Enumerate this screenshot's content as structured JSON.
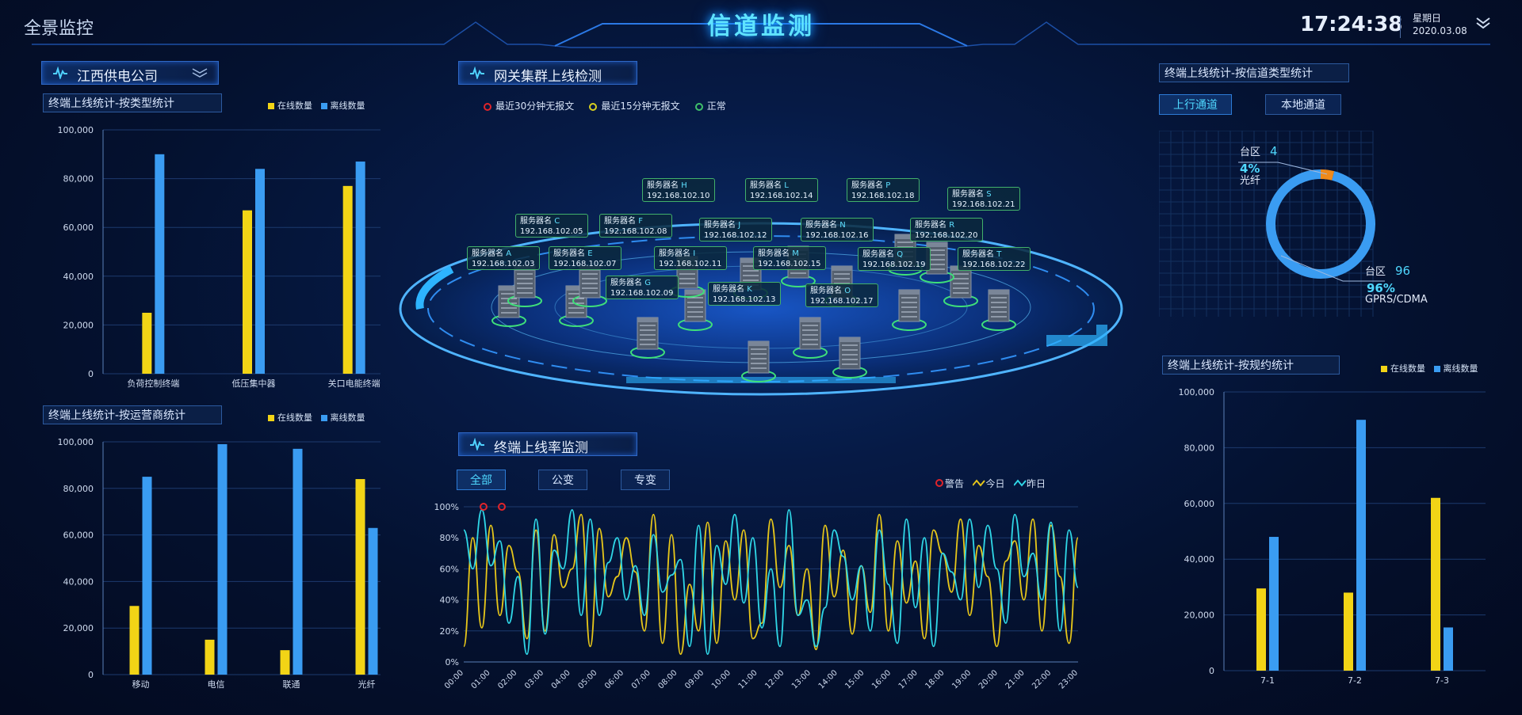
{
  "header": {
    "brand": "全景监控",
    "title": "信道监测",
    "time": "17:24:38",
    "weekday": "星期日",
    "date": "2020.03.08"
  },
  "left_panel": {
    "company": "江西供电公司"
  },
  "chart_type": {
    "title": "终端上线统计-按类型统计",
    "legend_online": "在线数量",
    "legend_offline": "离线数量"
  },
  "chart_operator": {
    "title": "终端上线统计-按运营商统计",
    "legend_online": "在线数量",
    "legend_offline": "离线数量"
  },
  "gateway": {
    "title": "网关集群上线检测",
    "legend": [
      "最近30分钟无报文",
      "最近15分钟无报文",
      "正常"
    ],
    "legend_colors": [
      "#e0242a",
      "#d8d020",
      "#3fc06a"
    ],
    "servers": [
      {
        "name": "服务器名",
        "id": "A",
        "ip": "192.168.102.03"
      },
      {
        "name": "服务器名",
        "id": "C",
        "ip": "192.168.102.05"
      },
      {
        "name": "服务器名",
        "id": "E",
        "ip": "192.168.102.07"
      },
      {
        "name": "服务器名",
        "id": "F",
        "ip": "192.168.102.08"
      },
      {
        "name": "服务器名",
        "id": "G",
        "ip": "192.168.102.09"
      },
      {
        "name": "服务器名",
        "id": "H",
        "ip": "192.168.102.10"
      },
      {
        "name": "服务器名",
        "id": "I",
        "ip": "192.168.102.11"
      },
      {
        "name": "服务器名",
        "id": "J",
        "ip": "192.168.102.12"
      },
      {
        "name": "服务器名",
        "id": "K",
        "ip": "192.168.102.13"
      },
      {
        "name": "服务器名",
        "id": "L",
        "ip": "192.168.102.14"
      },
      {
        "name": "服务器名",
        "id": "M",
        "ip": "192.168.102.15"
      },
      {
        "name": "服务器名",
        "id": "N",
        "ip": "192.168.102.16"
      },
      {
        "name": "服务器名",
        "id": "O",
        "ip": "192.168.102.17"
      },
      {
        "name": "服务器名",
        "id": "P",
        "ip": "192.168.102.18"
      },
      {
        "name": "服务器名",
        "id": "Q",
        "ip": "192.168.102.19"
      },
      {
        "name": "服务器名",
        "id": "R",
        "ip": "192.168.102.20"
      },
      {
        "name": "服务器名",
        "id": "S",
        "ip": "192.168.102.21"
      },
      {
        "name": "服务器名",
        "id": "T",
        "ip": "192.168.102.22"
      }
    ]
  },
  "rate": {
    "title": "终端上线率监测",
    "tabs": [
      "全部",
      "公变",
      "专变"
    ],
    "legend": [
      "警告",
      "今日",
      "昨日"
    ]
  },
  "channel": {
    "title": "终端上线统计-按信道类型统计",
    "tabs": [
      "上行通道",
      "本地通道"
    ],
    "slices": [
      {
        "label": "台区",
        "count": "4",
        "pct": "4%",
        "name": "光纤",
        "value": 4,
        "color": "#f08a1a"
      },
      {
        "label": "台区",
        "count": "96",
        "pct": "96%",
        "name": "GPRS/CDMA",
        "value": 96,
        "color": "#3a9cf2"
      }
    ]
  },
  "protocol": {
    "title": "终端上线统计-按规约统计",
    "legend_online": "在线数量",
    "legend_offline": "离线数量"
  },
  "colors": {
    "online": "#f2d416",
    "offline": "#3a9cf2",
    "today": "#e6c61a",
    "yesterday": "#2fd6e6",
    "warn": "#e0242a"
  },
  "chart_data": [
    {
      "type": "bar",
      "title": "终端上线统计-按类型统计",
      "categories": [
        "负荷控制终端",
        "低压集中器",
        "关口电能终端"
      ],
      "series": [
        {
          "name": "在线数量",
          "values": [
            25000,
            67000,
            77000
          ]
        },
        {
          "name": "离线数量",
          "values": [
            90000,
            84000,
            87000
          ]
        }
      ],
      "ylim": [
        0,
        100000
      ],
      "yticks": [
        "0",
        "20,000",
        "40,000",
        "60,000",
        "80,000",
        "100,000"
      ]
    },
    {
      "type": "bar",
      "title": "终端上线统计-按运营商统计",
      "categories": [
        "移动",
        "电信",
        "联通",
        "光纤"
      ],
      "series": [
        {
          "name": "在线数量",
          "values": [
            29500,
            15000,
            10500,
            84000
          ]
        },
        {
          "name": "离线数量",
          "values": [
            85000,
            99000,
            97000,
            63000
          ]
        }
      ],
      "ylim": [
        0,
        100000
      ],
      "yticks": [
        "0",
        "20,000",
        "40,000",
        "60,000",
        "80,000",
        "100,000"
      ]
    },
    {
      "type": "bar",
      "title": "终端上线统计-按规约统计",
      "categories": [
        "7-1",
        "7-2",
        "7-3"
      ],
      "series": [
        {
          "name": "在线数量",
          "values": [
            29500,
            28000,
            62000
          ]
        },
        {
          "name": "离线数量",
          "values": [
            48000,
            90000,
            15500
          ]
        }
      ],
      "ylim": [
        0,
        100000
      ],
      "yticks": [
        "0",
        "20,000",
        "40,000",
        "60,000",
        "80,000",
        "100,000"
      ]
    },
    {
      "type": "line",
      "title": "终端上线率监测",
      "x": [
        "00:00",
        "01:00",
        "02:00",
        "03:00",
        "04:00",
        "05:00",
        "06:00",
        "07:00",
        "08:00",
        "09:00",
        "10:00",
        "11:00",
        "12:00",
        "13:00",
        "14:00",
        "15:00",
        "16:00",
        "17:00",
        "18:00",
        "19:00",
        "20:00",
        "21:00",
        "22:00",
        "23:00"
      ],
      "yticks": [
        "0%",
        "20%",
        "40%",
        "60%",
        "80%",
        "100%"
      ],
      "ylim": [
        0,
        100
      ],
      "series": [
        {
          "name": "今日",
          "values": [
            10,
            80,
            22,
            88,
            30,
            75,
            58,
            15,
            85,
            20,
            82,
            48,
            60,
            95,
            10,
            86,
            42,
            55,
            80,
            58,
            20,
            95,
            12,
            82,
            5,
            50,
            20,
            90,
            12,
            78,
            40,
            85,
            15,
            25,
            92,
            48,
            75,
            30,
            60,
            8,
            88,
            42,
            72,
            18,
            62,
            32,
            95,
            20,
            78,
            38,
            65,
            15,
            85,
            70,
            45,
            92,
            30,
            75,
            55,
            10,
            65,
            78,
            40,
            92,
            20,
            88,
            55,
            12,
            80
          ]
        },
        {
          "name": "昨日",
          "values": [
            85,
            60,
            98,
            62,
            78,
            25,
            55,
            5,
            92,
            18,
            72,
            60,
            98,
            30,
            92,
            30,
            64,
            80,
            40,
            62,
            30,
            82,
            45,
            56,
            66,
            10,
            88,
            5,
            75,
            50,
            95,
            38,
            80,
            22,
            60,
            10,
            98,
            30,
            40,
            10,
            35,
            85,
            68,
            40,
            62,
            20,
            85,
            50,
            12,
            92,
            35,
            80,
            10,
            70,
            58,
            40,
            92,
            48,
            88,
            60,
            25,
            95,
            55,
            70,
            40,
            90,
            20,
            85,
            48
          ]
        },
        {
          "name": "警告",
          "values": [
            100,
            100
          ]
        }
      ]
    },
    {
      "type": "pie",
      "title": "终端上线统计-按信道类型统计",
      "categories": [
        "光纤",
        "GPRS/CDMA"
      ],
      "values": [
        4,
        96
      ]
    }
  ]
}
